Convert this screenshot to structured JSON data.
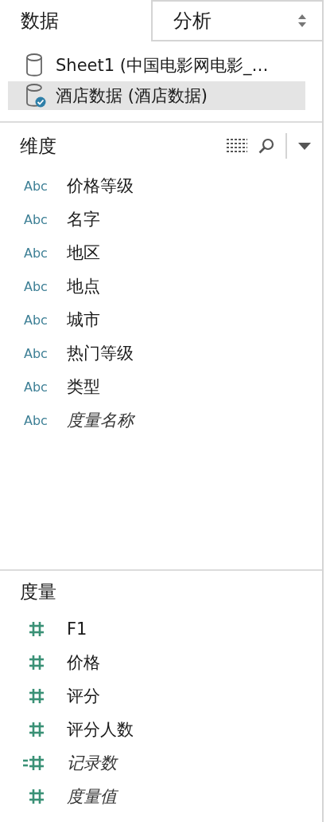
{
  "tabs": [
    {
      "label": "数据",
      "selected": true
    },
    {
      "label": "分析",
      "selected": false
    }
  ],
  "data_sources": [
    {
      "name": "Sheet1 (中国电影网电影_…",
      "selected": false,
      "connected": false
    },
    {
      "name": "酒店数据 (酒店数据)",
      "selected": true,
      "connected": true
    }
  ],
  "dimensions": {
    "title": "维度",
    "fields": [
      {
        "kind": "string",
        "icon": "Abc",
        "name": "价格等级",
        "generated": false
      },
      {
        "kind": "string",
        "icon": "Abc",
        "name": "名字",
        "generated": false
      },
      {
        "kind": "string",
        "icon": "Abc",
        "name": "地区",
        "generated": false
      },
      {
        "kind": "string",
        "icon": "Abc",
        "name": "地点",
        "generated": false
      },
      {
        "kind": "string",
        "icon": "Abc",
        "name": "城市",
        "generated": false
      },
      {
        "kind": "string",
        "icon": "Abc",
        "name": "热门等级",
        "generated": false
      },
      {
        "kind": "string",
        "icon": "Abc",
        "name": "类型",
        "generated": false
      },
      {
        "kind": "string",
        "icon": "Abc",
        "name": "度量名称",
        "generated": true
      }
    ]
  },
  "measures": {
    "title": "度量",
    "fields": [
      {
        "kind": "number",
        "name": "F1",
        "generated": false
      },
      {
        "kind": "number",
        "name": "价格",
        "generated": false
      },
      {
        "kind": "number",
        "name": "评分",
        "generated": false
      },
      {
        "kind": "number",
        "name": "评分人数",
        "generated": false
      },
      {
        "kind": "calculated",
        "name": "记录数",
        "generated": true
      },
      {
        "kind": "number",
        "name": "度量值",
        "generated": true
      }
    ]
  }
}
